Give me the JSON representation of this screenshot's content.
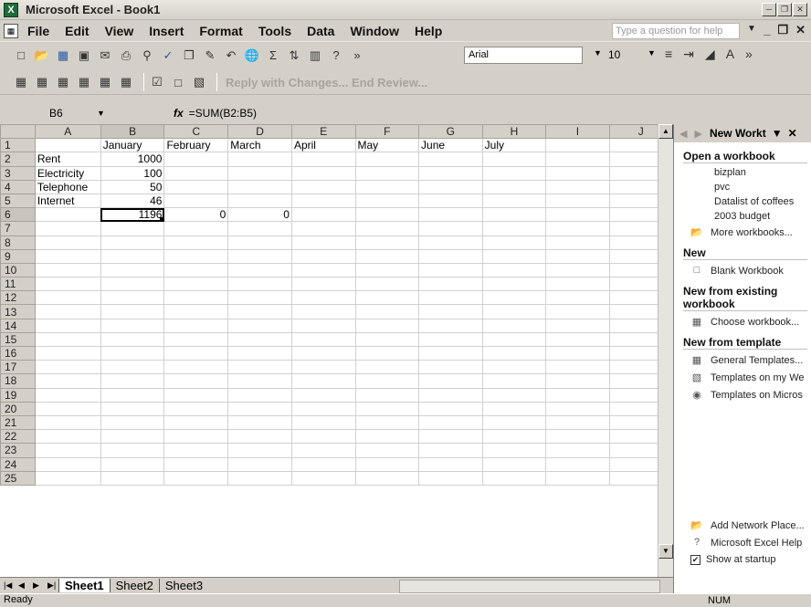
{
  "window": {
    "title": "Microsoft Excel - Book1"
  },
  "menu": {
    "items": [
      "File",
      "Edit",
      "View",
      "Insert",
      "Format",
      "Tools",
      "Data",
      "Window",
      "Help"
    ],
    "help_placeholder": "Type a question for help"
  },
  "toolbar": {
    "font": "Arial",
    "size": "10",
    "review": "Reply with Changes... End Review..."
  },
  "formula_bar": {
    "cell": "B6",
    "fx": "fx",
    "formula": "=SUM(B2:B5)"
  },
  "grid": {
    "columns": [
      "A",
      "B",
      "C",
      "D",
      "E",
      "F",
      "G",
      "H",
      "I",
      "J"
    ],
    "rows": [
      [
        "",
        "January",
        "February",
        "March",
        "April",
        "May",
        "June",
        "July",
        "",
        ""
      ],
      [
        "Rent",
        "1000",
        "",
        "",
        "",
        "",
        "",
        "",
        "",
        ""
      ],
      [
        "Electricity",
        "100",
        "",
        "",
        "",
        "",
        "",
        "",
        "",
        ""
      ],
      [
        "Telephone",
        "50",
        "",
        "",
        "",
        "",
        "",
        "",
        "",
        ""
      ],
      [
        "Internet",
        "46",
        "",
        "",
        "",
        "",
        "",
        "",
        "",
        ""
      ],
      [
        "",
        "1196",
        "0",
        "0",
        "",
        "",
        "",
        "",
        "",
        ""
      ],
      [
        "",
        "",
        "",
        "",
        "",
        "",
        "",
        "",
        "",
        ""
      ],
      [
        "",
        "",
        "",
        "",
        "",
        "",
        "",
        "",
        "",
        ""
      ],
      [
        "",
        "",
        "",
        "",
        "",
        "",
        "",
        "",
        "",
        ""
      ],
      [
        "",
        "",
        "",
        "",
        "",
        "",
        "",
        "",
        "",
        ""
      ],
      [
        "",
        "",
        "",
        "",
        "",
        "",
        "",
        "",
        "",
        ""
      ],
      [
        "",
        "",
        "",
        "",
        "",
        "",
        "",
        "",
        "",
        ""
      ],
      [
        "",
        "",
        "",
        "",
        "",
        "",
        "",
        "",
        "",
        ""
      ],
      [
        "",
        "",
        "",
        "",
        "",
        "",
        "",
        "",
        "",
        ""
      ],
      [
        "",
        "",
        "",
        "",
        "",
        "",
        "",
        "",
        "",
        ""
      ],
      [
        "",
        "",
        "",
        "",
        "",
        "",
        "",
        "",
        "",
        ""
      ],
      [
        "",
        "",
        "",
        "",
        "",
        "",
        "",
        "",
        "",
        ""
      ],
      [
        "",
        "",
        "",
        "",
        "",
        "",
        "",
        "",
        "",
        ""
      ],
      [
        "",
        "",
        "",
        "",
        "",
        "",
        "",
        "",
        "",
        ""
      ],
      [
        "",
        "",
        "",
        "",
        "",
        "",
        "",
        "",
        "",
        ""
      ],
      [
        "",
        "",
        "",
        "",
        "",
        "",
        "",
        "",
        "",
        ""
      ],
      [
        "",
        "",
        "",
        "",
        "",
        "",
        "",
        "",
        "",
        ""
      ],
      [
        "",
        "",
        "",
        "",
        "",
        "",
        "",
        "",
        "",
        ""
      ],
      [
        "",
        "",
        "",
        "",
        "",
        "",
        "",
        "",
        "",
        ""
      ],
      [
        "",
        "",
        "",
        "",
        "",
        "",
        "",
        "",
        "",
        ""
      ]
    ],
    "active_cell": "B6"
  },
  "sheets": [
    "Sheet1",
    "Sheet2",
    "Sheet3"
  ],
  "task_pane": {
    "title": "New Workt",
    "open_heading": "Open a workbook",
    "recent": [
      "bizplan",
      "pvc",
      "Datalist of coffees",
      "2003 budget"
    ],
    "more": "More workbooks...",
    "new_heading": "New",
    "blank": "Blank Workbook",
    "existing_heading": "New from existing workbook",
    "choose": "Choose workbook...",
    "template_heading": "New from template",
    "templates": [
      "General Templates...",
      "Templates on my We",
      "Templates on Micros"
    ],
    "network": "Add Network Place...",
    "help": "Microsoft Excel Help",
    "startup": "Show at startup"
  },
  "status": {
    "left": "Ready",
    "right": "NUM"
  }
}
